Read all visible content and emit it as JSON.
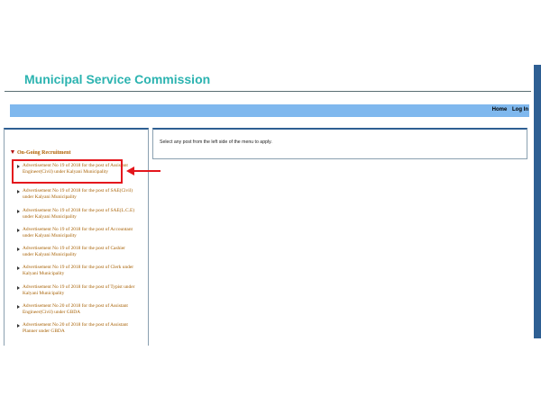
{
  "header": {
    "title": "Municipal Service Commission"
  },
  "navbar": {
    "links": [
      "Home",
      "Log In"
    ]
  },
  "menu": {
    "heading": "On-Going Recruitment",
    "items": [
      "Advertisement No 19 of 2018 for the post of Assistant Engineer(Civil) under Kalyani Municipality",
      "Advertisement No 19 of 2018 for the post of SAE(Civil) under Kalyani Municipality",
      "Advertisement No 19 of 2018 for the post of SAE(L.C.E) under Kalyani Municipality",
      "Advertisement No 19 of 2018 for the post of Accountant under Kalyani Municipality",
      "Advertisement No 19 of 2018 for the post of Cashier under Kalyani Municipality",
      "Advertisement No 19 of 2018 for the post of Clerk under Kalyani Municipality",
      "Advertisement No 19 of 2018 for the post of Typist under Kalyani Municipality",
      "Advertisement No 20 of 2018 for the post of Assistant Engineer(Civil) under GBDA",
      "Advertisement No 20 of 2018 for the post of Assistant Planner under GBDA"
    ]
  },
  "content": {
    "message": "Select any post from the left side of the menu to apply."
  },
  "colors": {
    "title": "#2bb3b0",
    "navbar": "#7fb8ee",
    "menu_link": "#a65f00",
    "highlight": "#e4161c",
    "frame": "#2e5f93"
  }
}
